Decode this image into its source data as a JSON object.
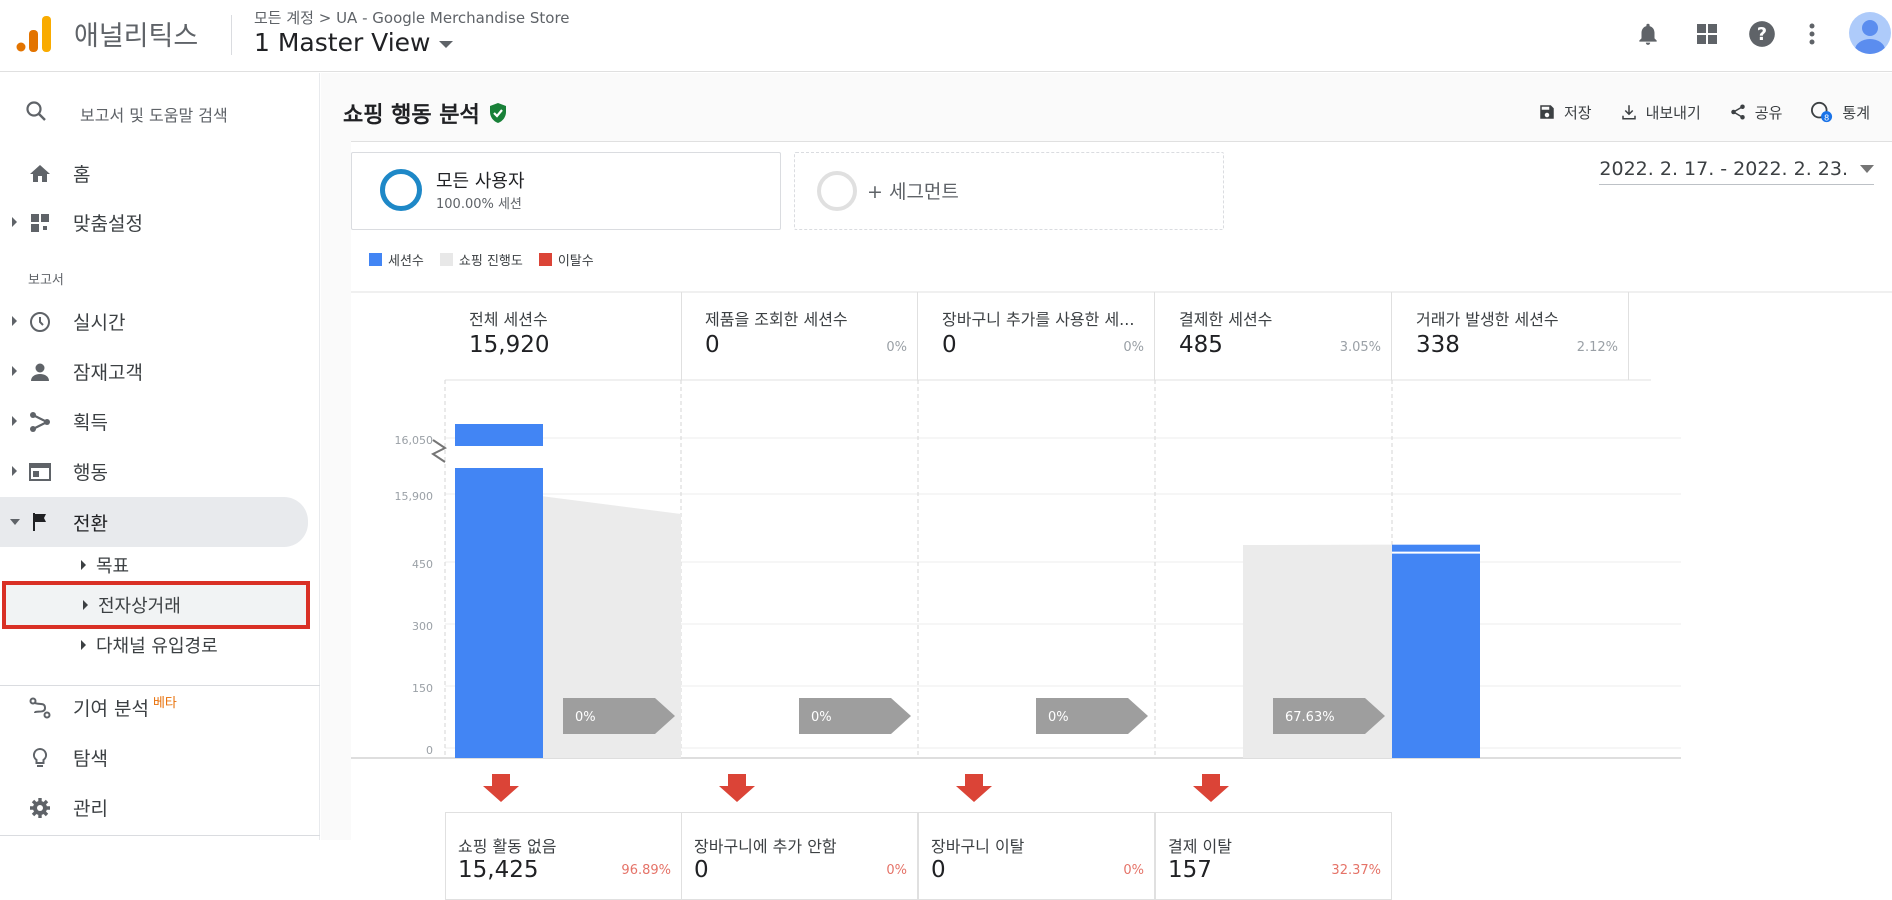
{
  "header": {
    "brand": "애널리틱스",
    "breadcrumb": "모든 계정 > UA - Google Merchandise Store",
    "view": "1 Master View",
    "icons": [
      "notifications-icon",
      "apps-icon",
      "help-icon",
      "more-vert-icon",
      "account-icon"
    ]
  },
  "sidebar": {
    "search_placeholder": "보고서 및 도움말 검색",
    "home": "홈",
    "customization": "맞춤설정",
    "reports_section": "보고서",
    "realtime": "실시간",
    "audience": "잠재고객",
    "acquisition": "획득",
    "behavior": "행동",
    "conversions": "전환",
    "goals": "목표",
    "ecommerce": "전자상거래",
    "multichannel": "다채널 유입경로",
    "attribution": "기여 분석",
    "beta": "베타",
    "discover": "탐색",
    "admin": "관리"
  },
  "main": {
    "title": "쇼핑 행동 분석",
    "actions": {
      "save": "저장",
      "export": "내보내기",
      "share": "공유",
      "insights": "통계",
      "insights_badge": "8"
    },
    "segments": {
      "all_users": "모든 사용자",
      "all_users_sub": "100.00% 세션",
      "add_segment": "+ 세그먼트"
    },
    "date_range": "2022. 2. 17. - 2022. 2. 23.",
    "legend": {
      "sessions": "세션수",
      "progress": "쇼핑 진행도",
      "abandon": "이탈수"
    },
    "colors": {
      "sessions": "#4285f4",
      "progress": "#e8e8e8",
      "abandon": "#db4437",
      "badge": "#9e9e9e"
    }
  },
  "chart_data": {
    "type": "bar",
    "yaxis_ticks": [
      "16,050",
      "15,900",
      "450",
      "300",
      "150",
      "0"
    ],
    "stages": [
      {
        "label": "전체 세션수",
        "value": "15,920",
        "pct": ""
      },
      {
        "label": "제품을 조회한 세션수",
        "value": "0",
        "pct": "0%"
      },
      {
        "label": "장바구니 추가를 사용한 세...",
        "value": "0",
        "pct": "0%"
      },
      {
        "label": "결제한 세션수",
        "value": "485",
        "pct": "3.05%"
      },
      {
        "label": "거래가 발생한 세션수",
        "value": "338",
        "pct": "2.12%"
      }
    ],
    "values": [
      15920,
      0,
      0,
      485,
      338
    ],
    "conversion_badges": [
      "0%",
      "0%",
      "0%",
      "67.63%"
    ],
    "abandonment": [
      {
        "label": "쇼핑 활동 없음",
        "value": "15,425",
        "pct": "96.89%"
      },
      {
        "label": "장바구니에 추가 안함",
        "value": "0",
        "pct": "0%"
      },
      {
        "label": "장바구니 이탈",
        "value": "0",
        "pct": "0%"
      },
      {
        "label": "결제 이탈",
        "value": "157",
        "pct": "32.37%"
      }
    ]
  }
}
